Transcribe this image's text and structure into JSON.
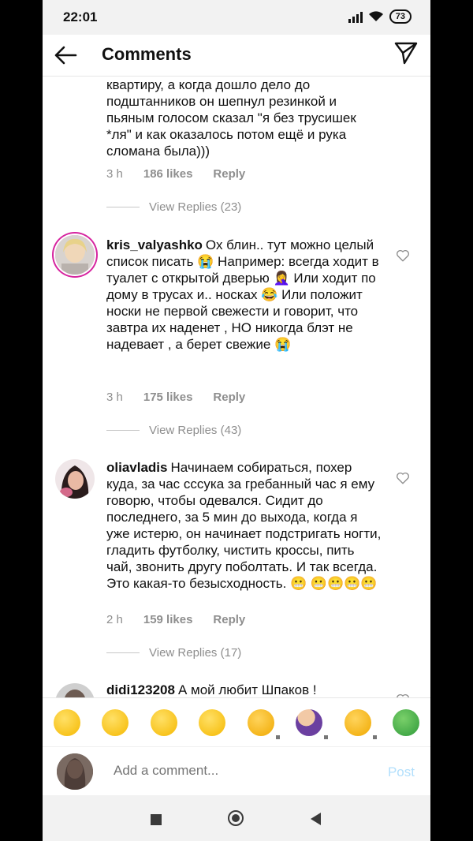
{
  "status": {
    "time": "22:01",
    "battery": "73"
  },
  "header": {
    "title": "Comments"
  },
  "comments": [
    {
      "text": "одежду что бы не воняли костром на всю квартиру, а когда дошло дело до подштанников он шепнул резинкой и пьяным голосом сказал \"я без трусишек *ля\" и как оказалось потом ещё и рука сломана была)))",
      "time": "3 h",
      "likes": "186 likes",
      "reply": "Reply",
      "view_replies": "View Replies (23)"
    },
    {
      "user": "kris_valyashko",
      "text": "Ох блин.. тут можно целый список писать 😭 Например: всегда ходит в туалет с открытой дверью 🤦‍♀️ Или ходит по дому в трусах и.. носках 😂 Или положит носки не первой свежести и говорит, что завтра их наденет , НО никогда блэт не надевает , а берет свежие 😭",
      "time": "3 h",
      "likes": "175 likes",
      "reply": "Reply",
      "view_replies": "View Replies (43)"
    },
    {
      "user": "oliavladis",
      "text": "Начинаем собираться, похер куда, за час сссука за гребанный час я ему говорю, чтобы одевался. Сидит до последнего, за 5 мин до выхода, когда я уже истерю, он начинает подстригать ногти, гладить футболку, чистить кроссы, пить чай, звонить другу поболтать. И так всегда. Это какая-то безысходность. 😬 😬😬😬😬",
      "time": "2 h",
      "likes": "159 likes",
      "reply": "Reply",
      "view_replies": "View Replies (17)"
    },
    {
      "user": "didi123208",
      "text": "А мой любит Шпаков !"
    }
  ],
  "emoji_bar": [
    "rofl-emoji",
    "joy-emoji",
    "grin-emoji",
    "heart-eyes-emoji",
    "clap-emoji",
    "facepalm-emoji",
    "raised-hands-emoji",
    "snake-emoji"
  ],
  "input": {
    "placeholder": "Add a comment...",
    "post_label": "Post"
  },
  "colors": {
    "accent": "#0095f6",
    "post_disabled": "#b2dffc",
    "story_ring": "#d6249f",
    "meta_gray": "#8e8e8e"
  }
}
